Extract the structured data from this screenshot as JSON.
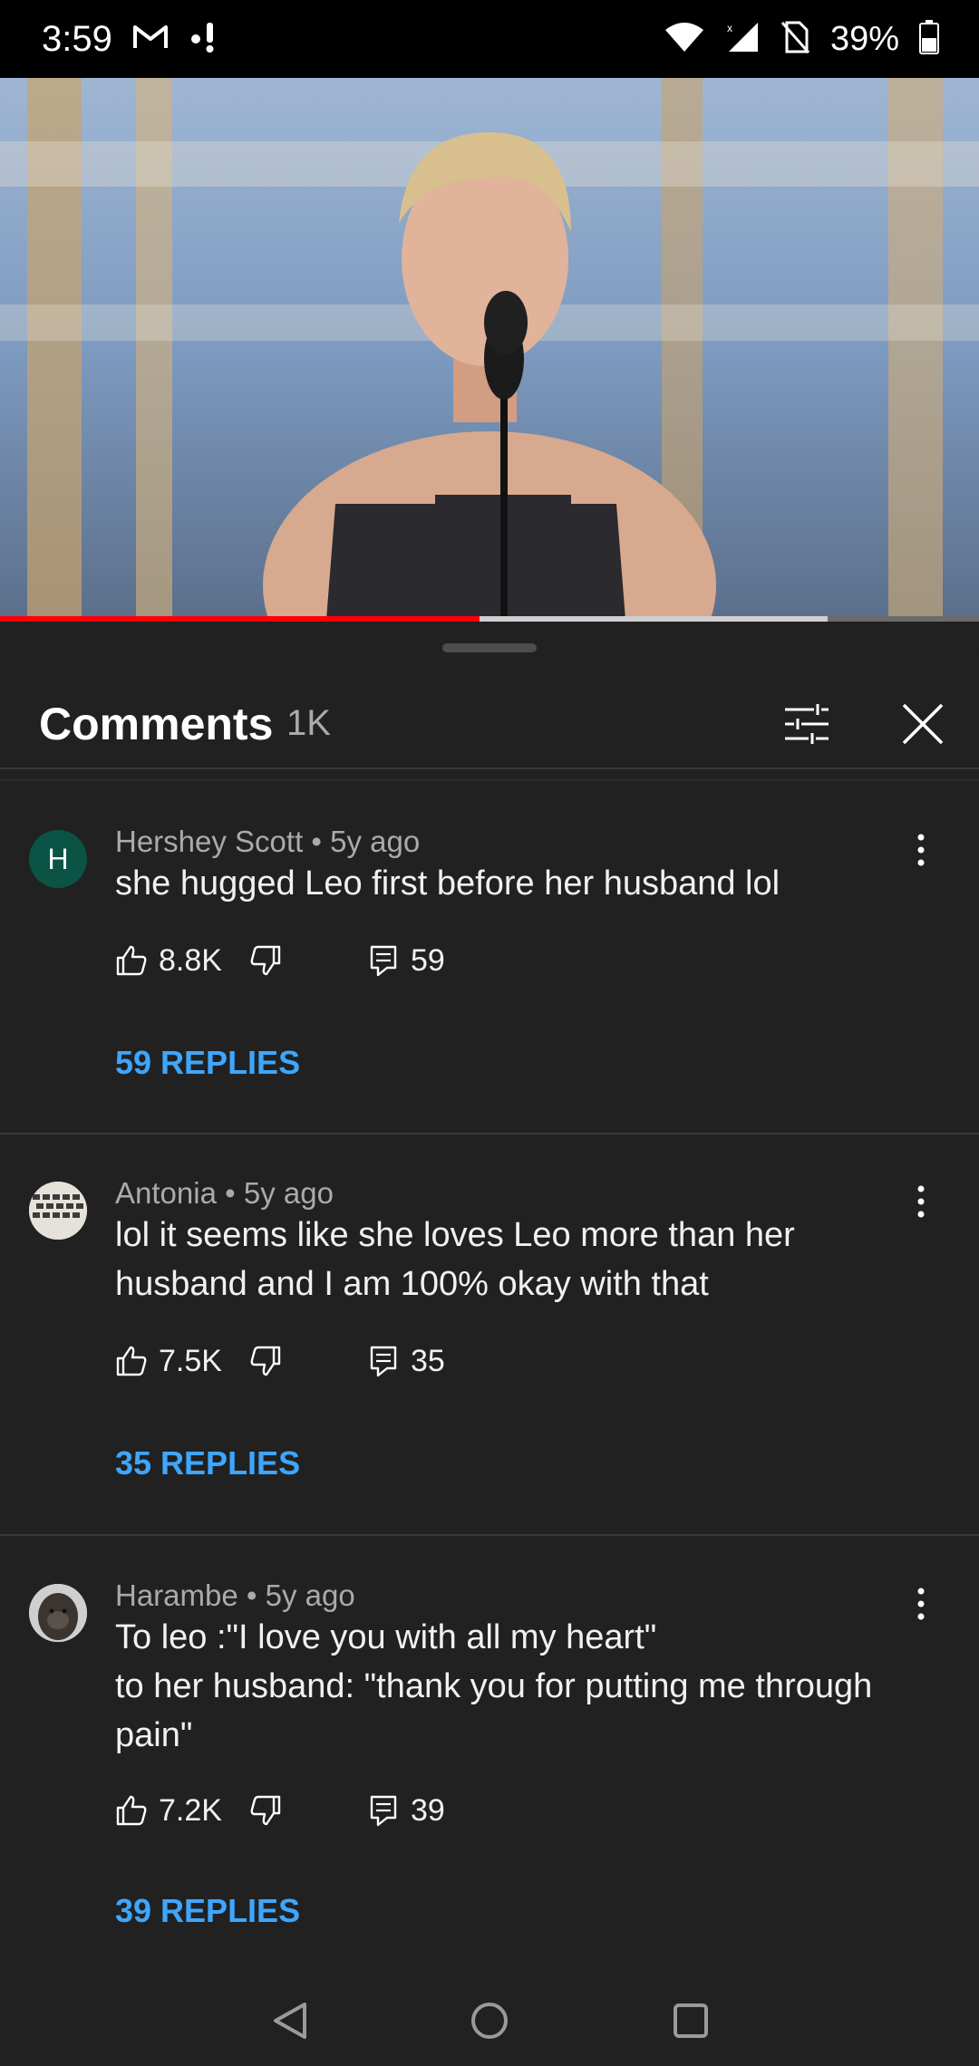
{
  "status_bar": {
    "time": "3:59",
    "battery_pct": "39%",
    "icons": [
      "gmail-icon",
      "notification-icon",
      "wifi-icon",
      "signal-icon",
      "no-sim-icon",
      "battery-icon"
    ]
  },
  "video": {
    "progress_played_fraction": 0.49,
    "progress_buffered_fraction": 0.845
  },
  "comments_panel": {
    "title": "Comments",
    "count": "1K",
    "filter_icon": "sliders-icon",
    "close_icon": "close-icon"
  },
  "comments": [
    {
      "author": "Hershey Scott",
      "time": "5y ago",
      "avatar_letter": "H",
      "avatar_color": "#0b5345",
      "text": "she hugged Leo first before her husband lol",
      "likes": "8.8K",
      "reply_count": "59",
      "replies_label": "59 REPLIES"
    },
    {
      "author": "Antonia",
      "time": "5y ago",
      "text": "lol it seems like she loves Leo more than her husband and I am 100% okay with that",
      "likes": "7.5K",
      "reply_count": "35",
      "replies_label": "35 REPLIES"
    },
    {
      "author": "Harambe",
      "time": "5y ago",
      "text_lines": [
        "To leo :\"I love you with all my heart\"",
        "to her husband: \"thank you for putting me through pain\""
      ],
      "likes": "7.2K",
      "reply_count": "39",
      "replies_label": "39 REPLIES"
    }
  ],
  "colors": {
    "accent_link": "#3ea6ff",
    "progress_red": "#ff0000",
    "background": "#212121"
  }
}
